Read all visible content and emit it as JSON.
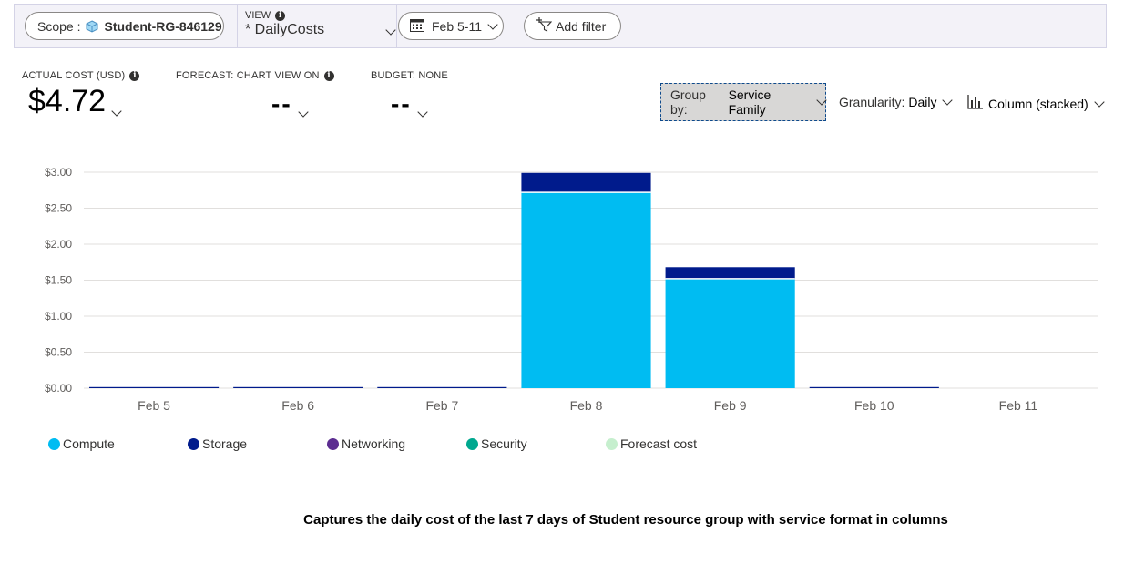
{
  "toolbar": {
    "scope_label": "Scope :",
    "scope_name": "Student-RG-846129",
    "view_label": "VIEW",
    "view_value": "* DailyCosts",
    "date_range": "Feb 5-11",
    "add_filter": "Add filter"
  },
  "kpis": {
    "actual_label": "ACTUAL COST (USD)",
    "actual_value": "$4.72",
    "forecast_label": "FORECAST: CHART VIEW ON",
    "forecast_value": "--",
    "budget_label": "BUDGET: NONE",
    "budget_value": "--"
  },
  "controls": {
    "groupby_label": "Group by:",
    "groupby_value": "Service Family",
    "granularity_label": "Granularity:",
    "granularity_value": "Daily",
    "chart_type": "Column (stacked)"
  },
  "legend": [
    {
      "name": "Compute",
      "color": "#00bcf2"
    },
    {
      "name": "Storage",
      "color": "#001b8c"
    },
    {
      "name": "Networking",
      "color": "#5c2d91"
    },
    {
      "name": "Security",
      "color": "#00a88f"
    },
    {
      "name": "Forecast cost",
      "color": "#c6efce"
    }
  ],
  "chart_data": {
    "type": "bar",
    "stacked": true,
    "categories": [
      "Feb 5",
      "Feb 6",
      "Feb 7",
      "Feb 8",
      "Feb 9",
      "Feb 10",
      "Feb 11"
    ],
    "series": [
      {
        "name": "Compute",
        "color": "#00bcf2",
        "values": [
          0,
          0,
          0,
          2.72,
          1.52,
          0,
          0
        ]
      },
      {
        "name": "Storage",
        "color": "#001b8c",
        "values": [
          0.01,
          0.01,
          0.01,
          0.27,
          0.16,
          0.01,
          0
        ]
      }
    ],
    "yticks": [
      "$3.00",
      "$2.50",
      "$2.00",
      "$1.50",
      "$1.00",
      "$0.50",
      "$0.00"
    ],
    "ylim": [
      0,
      3
    ],
    "grid": true,
    "legend_position": "bottom-left"
  },
  "caption": "Captures the daily cost of the last 7 days of Student resource group with service format in columns"
}
